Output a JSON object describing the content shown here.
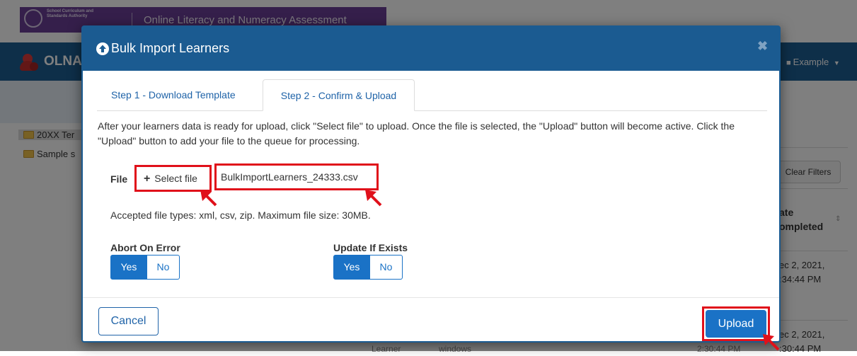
{
  "background": {
    "banner": {
      "authority": "School Curriculum and Standards Authority",
      "title": "Online Literacy and Numeracy Assessment"
    },
    "navbar": {
      "brand": "OLNA",
      "user": "Example",
      "user_icon": "user-icon",
      "caret_icon": "caret-down-icon"
    },
    "sidebar": {
      "items": [
        {
          "label": "20XX Ter",
          "selected": true
        },
        {
          "label": "Sample s",
          "selected": false
        }
      ]
    },
    "toolbar": {
      "clear_filters": "Clear Filters"
    },
    "table": {
      "date_header_line1": "ate",
      "date_header_line2": "ompleted",
      "rows": [
        {
          "line1": "ec 2, 2021,",
          "line2": ":34:44 PM"
        },
        {
          "line1": "ec 2, 2021,",
          "line2": ":30:44 PM"
        }
      ],
      "bottom_cells": [
        "Learner",
        "windows",
        "2:30:44 PM"
      ]
    }
  },
  "modal": {
    "title": "Bulk Import Learners",
    "title_icon": "upload-circle-icon",
    "close_icon": "close-icon",
    "tabs": [
      {
        "label": "Step 1 - Download Template",
        "active": false
      },
      {
        "label": "Step 2 - Confirm & Upload",
        "active": true
      }
    ],
    "instructions": "After your learners data is ready for upload, click \"Select file\" to upload. Once the file is selected, the \"Upload\" button will become active. Click the \"Upload\" button to add your file to the queue for processing.",
    "file": {
      "label": "File",
      "select_label": "Select file",
      "select_icon": "plus-icon",
      "selected_filename": "BulkImportLearners_24333.csv"
    },
    "accepted_types": "Accepted file types: xml, csv, zip. Maximum file size: 30MB.",
    "abort_on_error": {
      "label": "Abort On Error",
      "options": [
        "Yes",
        "No"
      ],
      "selected": "Yes"
    },
    "update_if_exists": {
      "label": "Update If Exists",
      "options": [
        "Yes",
        "No"
      ],
      "selected": "Yes"
    },
    "cancel_label": "Cancel",
    "upload_label": "Upload"
  },
  "colors": {
    "primary": "#1a72c6",
    "header": "#1b5b91",
    "highlight": "#e0101a",
    "banner": "#6b3f97"
  }
}
